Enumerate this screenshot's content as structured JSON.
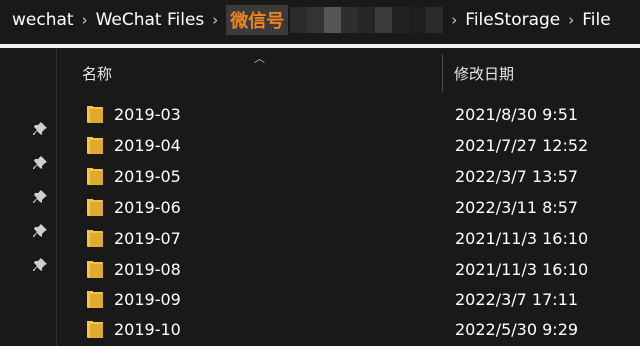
{
  "breadcrumb": {
    "items": [
      "wechat",
      "WeChat Files",
      "微信号",
      "FileStorage",
      "File"
    ],
    "separator": "›",
    "highlight_color": "#f0851f"
  },
  "columns": {
    "name": "名称",
    "date_modified": "修改日期"
  },
  "rows": [
    {
      "name": "2019-03",
      "date": "2021/8/30 9:51"
    },
    {
      "name": "2019-04",
      "date": "2021/7/27 12:52"
    },
    {
      "name": "2019-05",
      "date": "2022/3/7 13:57"
    },
    {
      "name": "2019-06",
      "date": "2022/3/11 8:57"
    },
    {
      "name": "2019-07",
      "date": "2021/11/3 16:10"
    },
    {
      "name": "2019-08",
      "date": "2021/11/3 16:10"
    },
    {
      "name": "2019-09",
      "date": "2022/3/7 17:11"
    },
    {
      "name": "2019-10",
      "date": "2022/5/30 9:29"
    }
  ],
  "icons": {
    "pin": "pin-icon",
    "folder": "folder-icon",
    "sort": "sort-up-icon"
  },
  "colors": {
    "background": "#191919",
    "folder": "#f5c444",
    "text": "#ffffff"
  }
}
